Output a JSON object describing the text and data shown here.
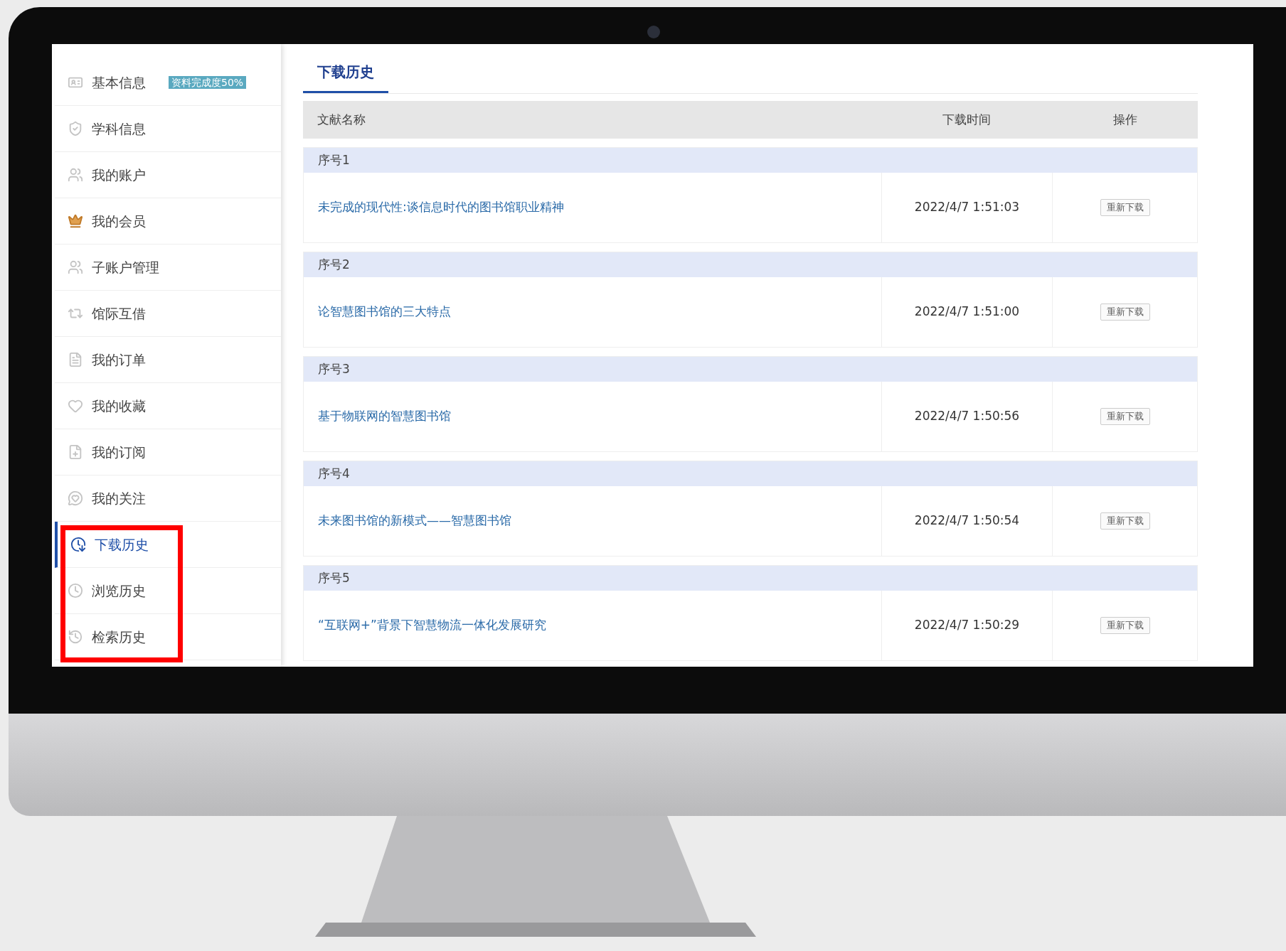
{
  "sidebar": {
    "items": [
      {
        "label": "基本信息",
        "badge": "资料完成度50%",
        "selected": false
      },
      {
        "label": "学科信息",
        "selected": false
      },
      {
        "label": "我的账户",
        "selected": false
      },
      {
        "label": "我的会员",
        "selected": false
      },
      {
        "label": "子账户管理",
        "selected": false
      },
      {
        "label": "馆际互借",
        "selected": false
      },
      {
        "label": "我的订单",
        "selected": false
      },
      {
        "label": "我的收藏",
        "selected": false
      },
      {
        "label": "我的订阅",
        "selected": false
      },
      {
        "label": "我的关注",
        "selected": false
      },
      {
        "label": "下载历史",
        "selected": true
      },
      {
        "label": "浏览历史",
        "selected": false
      },
      {
        "label": "检索历史",
        "selected": false
      }
    ]
  },
  "tabs": [
    {
      "label": "下载历史",
      "selected": true
    }
  ],
  "table": {
    "columns": [
      "文献名称",
      "下载时间",
      "操作"
    ],
    "rows": [
      {
        "number": "序号1",
        "title": "未完成的现代性:谈信息时代的图书馆职业精神",
        "time": "2022/4/7 1:51:03",
        "action": "重新下载"
      },
      {
        "number": "序号2",
        "title": "论智慧图书馆的三大特点",
        "time": "2022/4/7 1:51:00",
        "action": "重新下载"
      },
      {
        "number": "序号3",
        "title": "基于物联网的智慧图书馆",
        "time": "2022/4/7 1:50:56",
        "action": "重新下载"
      },
      {
        "number": "序号4",
        "title": "未来图书馆的新模式——智慧图书馆",
        "time": "2022/4/7 1:50:54",
        "action": "重新下载"
      },
      {
        "number": "序号5",
        "title": "“互联网+”背景下智慧物流一体化发展研究",
        "time": "2022/4/7 1:50:29",
        "action": "重新下载"
      }
    ]
  }
}
